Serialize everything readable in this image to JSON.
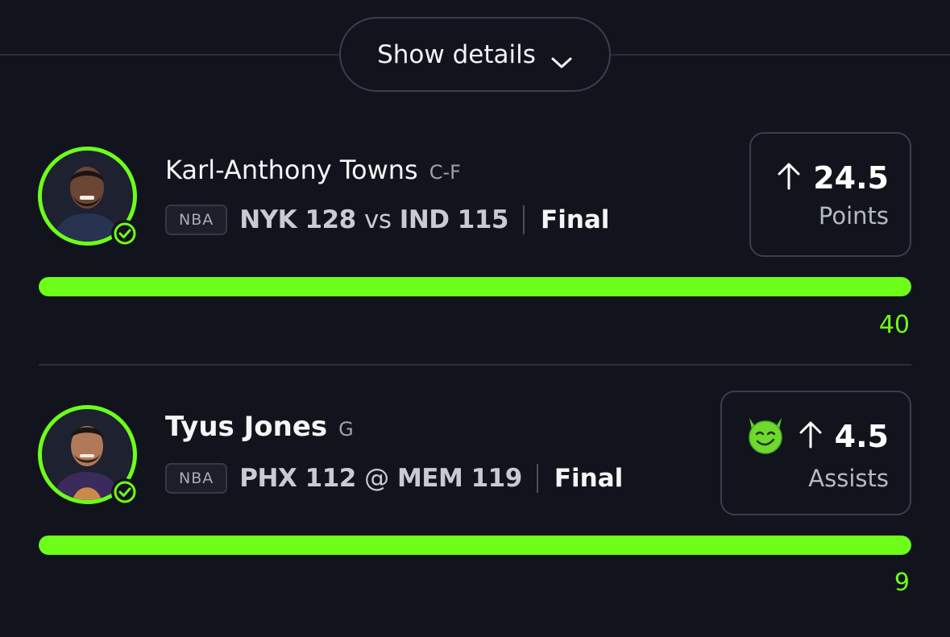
{
  "header": {
    "show_details_label": "Show details",
    "chevron_icon": "chevron-down-icon"
  },
  "colors": {
    "background": "#12141d",
    "accent_green": "#6dff1a",
    "border": "#3a3e4c"
  },
  "picks": [
    {
      "player_name": "Karl-Anthony Towns",
      "position": "C-F",
      "league": "NBA",
      "matchup": {
        "team1": "NYK",
        "score1": "128",
        "separator": "vs",
        "team2": "IND",
        "score2": "115"
      },
      "status": "Final",
      "direction_icon": "arrow-up-icon",
      "line": "24.5",
      "stat": "Points",
      "actual": "40",
      "progress": 1.0,
      "status_icon": "check-circle-icon"
    },
    {
      "player_name": "Tyus Jones",
      "position": "G",
      "league": "NBA",
      "matchup": {
        "team1": "PHX",
        "score1": "112",
        "separator": "@",
        "team2": "MEM",
        "score2": "119"
      },
      "status": "Final",
      "badge_icon": "devil-emoji-icon",
      "direction_icon": "arrow-up-icon",
      "line": "4.5",
      "stat": "Assists",
      "actual": "9",
      "progress": 1.0,
      "status_icon": "check-circle-icon"
    }
  ]
}
